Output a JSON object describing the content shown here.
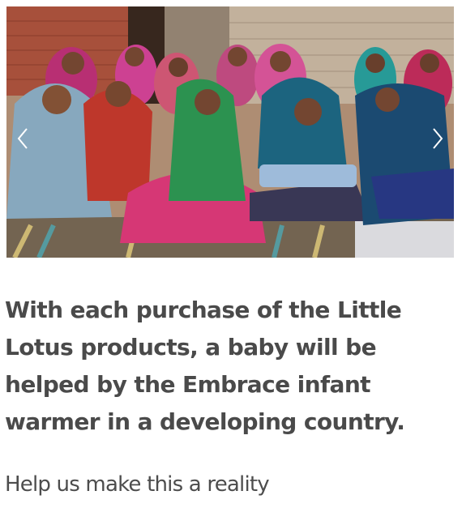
{
  "carousel": {
    "image_description": "",
    "prev_icon": "chevron-left-icon",
    "next_icon": "chevron-right-icon"
  },
  "headline": "With each purchase of the Little Lotus products, a baby will be helped by the Embrace infant warmer in a developing country.",
  "cta": "Help us make this a reality",
  "colors": {
    "text": "#4a4a4a",
    "background": "#ffffff"
  }
}
